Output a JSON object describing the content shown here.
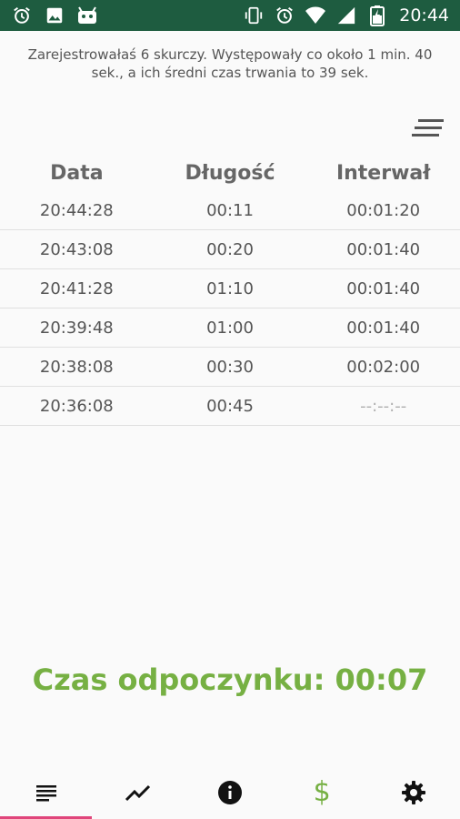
{
  "status_bar": {
    "time": "20:44",
    "left_icons": [
      "alarm-icon",
      "image-icon",
      "android-icon"
    ],
    "right_icons": [
      "vibrate-icon",
      "alarm-icon",
      "wifi-icon",
      "signal-icon",
      "battery-icon"
    ]
  },
  "summary": "Zarejestrowałaś 6 skurczy. Występowały co około 1 min. 40 sek., a ich średni czas trwania to 39 sek.",
  "sort_icon": "sort-icon",
  "table": {
    "headers": [
      "Data",
      "Długość",
      "Interwał"
    ],
    "rows": [
      [
        "20:44:28",
        "00:11",
        "00:01:20"
      ],
      [
        "20:43:08",
        "00:20",
        "00:01:40"
      ],
      [
        "20:41:28",
        "01:10",
        "00:01:40"
      ],
      [
        "20:39:48",
        "01:00",
        "00:01:40"
      ],
      [
        "20:38:08",
        "00:30",
        "00:02:00"
      ],
      [
        "20:36:08",
        "00:45",
        "--:--:--"
      ]
    ]
  },
  "rest_label": "Czas odpoczynku: 00:07",
  "colors": {
    "status_bar": "#1e5c40",
    "accent_green": "#76b043",
    "active_tab": "#e0457b"
  },
  "bottom_nav": {
    "items": [
      "list-icon",
      "chart-icon",
      "info-icon",
      "dollar-icon",
      "settings-icon"
    ],
    "dollar_symbol": "$",
    "active_index": 0
  }
}
